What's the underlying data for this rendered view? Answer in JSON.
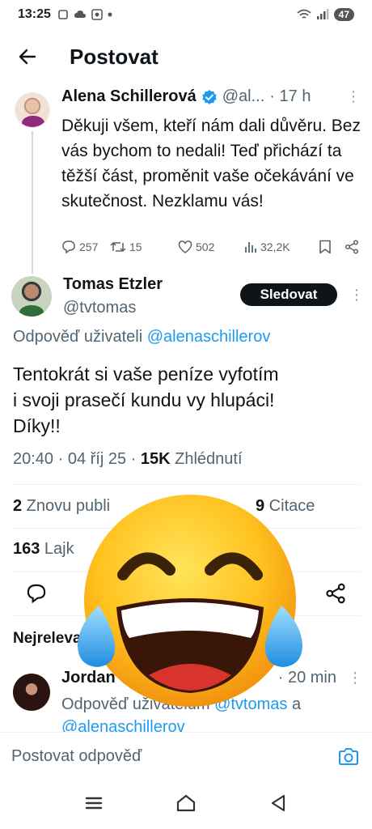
{
  "status_bar": {
    "time": "13:25",
    "battery": "47"
  },
  "header": {
    "title": "Postovat"
  },
  "parent_tweet": {
    "name": "Alena Schillerová",
    "handle": "@al...",
    "time": "· 17 h",
    "text": "Děkuji všem, kteří nám dali důvěru. Bez vás bychom to nedali! Teď přichází ta těžší část, proměnit vaše očekávání ve skutečnost. Nezklamu vás!",
    "replies": "257",
    "reposts": "15",
    "likes": "502",
    "views": "32,2K"
  },
  "main_tweet": {
    "name": "Tomas Etzler",
    "handle": "@tvtomas",
    "follow_label": "Sledovat",
    "reply_prefix": "Odpověď uživateli",
    "reply_mention": "@alenaschillerov",
    "text_line1": "Tentokrát si vaše peníze vyfotím",
    "text_line2": "i svoji prasečí kundu vy hlupáci!",
    "text_line3": "Díky!!",
    "time_date": "20:40 · 04 říj 25 · ",
    "views_count": "15K",
    "views_label": " Zhlédnutí",
    "reposts_count": "2",
    "reposts_label": " Znovu publi",
    "quotes_count": "9",
    "quotes_label": " Citace",
    "likes_count": "163",
    "likes_label": " Lajk"
  },
  "replies_section": {
    "title": "Nejreleva"
  },
  "reply1": {
    "name": "Jordan",
    "time": "· 20 min",
    "prefix": "Odpověď uživatelům",
    "mention1": "@tvtomas",
    "connector": " a ",
    "mention2": "@alenaschillerov"
  },
  "composer": {
    "placeholder": "Postovat odpověď"
  },
  "colors": {
    "accent": "#1d9bf0",
    "text": "#0f1419",
    "muted": "#536471"
  },
  "icons": [
    "back-arrow-icon",
    "verified-icon",
    "reply-icon",
    "repost-icon",
    "like-icon",
    "views-icon",
    "bookmark-icon",
    "share-icon",
    "camera-icon",
    "menu-icon",
    "home-icon",
    "back-nav-icon",
    "laughing-emoji"
  ]
}
